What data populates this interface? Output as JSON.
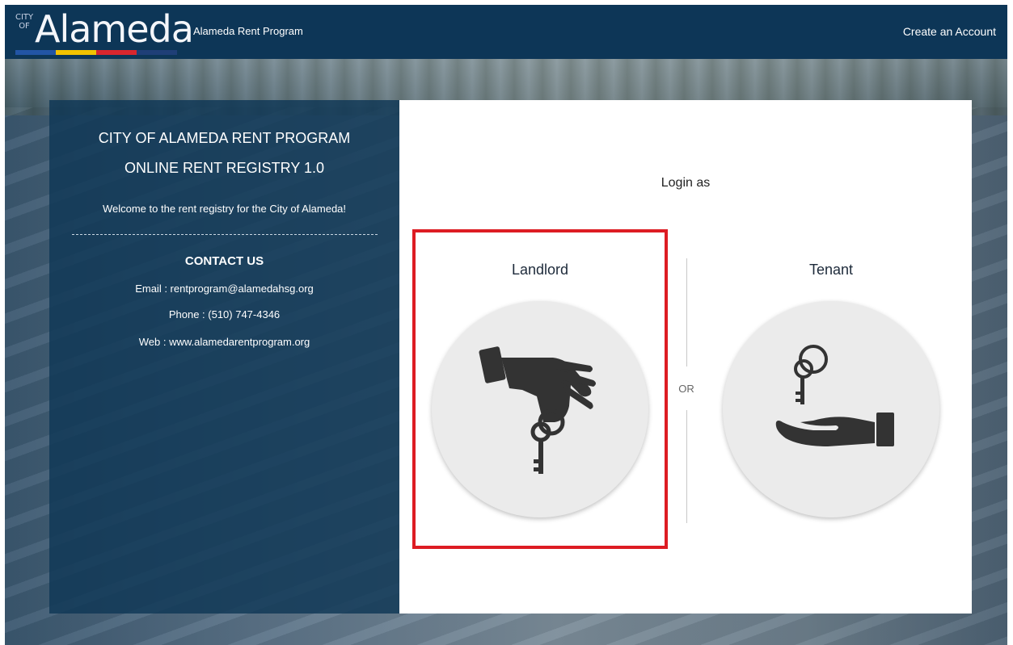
{
  "header": {
    "logo_city": "CITY OF",
    "logo_word": "Alameda",
    "site_name": "Alameda Rent Program",
    "create_account": "Create an Account",
    "logo_colors": [
      "#2255a5",
      "#f2c200",
      "#d8262e",
      "#1f3f77"
    ]
  },
  "info": {
    "title_line1": "CITY OF ALAMEDA RENT PROGRAM",
    "title_line2": "ONLINE RENT REGISTRY 1.0",
    "welcome": "Welcome to the rent registry for the City of Alameda!",
    "contact_heading": "CONTACT US",
    "email": "Email : rentprogram@alamedahsg.org",
    "phone": "Phone : (510) 747-4346",
    "web": "Web : www.alamedarentprogram.org"
  },
  "login": {
    "heading": "Login as",
    "landlord_label": "Landlord",
    "tenant_label": "Tenant",
    "or_text": "OR",
    "landlord_icon": "hand-giving-key-icon",
    "tenant_icon": "hand-receiving-key-icon",
    "highlight_color": "#dd1c23"
  }
}
